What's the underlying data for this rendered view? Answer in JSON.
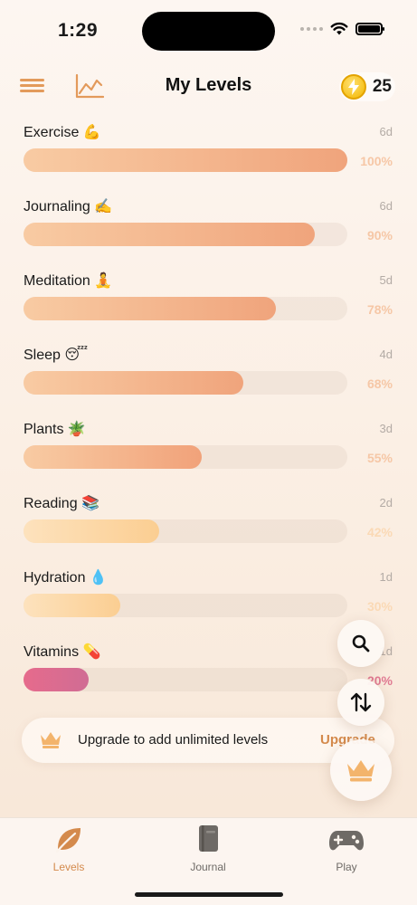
{
  "status_bar": {
    "time": "1:29"
  },
  "header": {
    "title": "My Levels",
    "coin_count": "25"
  },
  "levels": [
    {
      "name": "Exercise 💪",
      "days": "6d",
      "percent_label": "100%",
      "progress": 1.0,
      "fill_start": "#f8cba3",
      "fill_end": "#f0a47c",
      "pct_color": "#f6c7a6"
    },
    {
      "name": "Journaling ✍️",
      "days": "6d",
      "percent_label": "90%",
      "progress": 0.9,
      "fill_start": "#f8cba3",
      "fill_end": "#f0a47c",
      "pct_color": "#f6c7a6"
    },
    {
      "name": "Meditation 🧘",
      "days": "5d",
      "percent_label": "78%",
      "progress": 0.78,
      "fill_start": "#f8cba3",
      "fill_end": "#f0a47c",
      "pct_color": "#f6c7a6"
    },
    {
      "name": "Sleep 😴",
      "days": "4d",
      "percent_label": "68%",
      "progress": 0.68,
      "fill_start": "#f8cba3",
      "fill_end": "#f0a47c",
      "pct_color": "#f6c7a6"
    },
    {
      "name": "Plants 🪴",
      "days": "3d",
      "percent_label": "55%",
      "progress": 0.55,
      "fill_start": "#f8cba3",
      "fill_end": "#f1a27a",
      "pct_color": "#f6c7a6"
    },
    {
      "name": "Reading 📚",
      "days": "2d",
      "percent_label": "42%",
      "progress": 0.42,
      "fill_start": "#fde2bd",
      "fill_end": "#fbce92",
      "pct_color": "#fad9b5"
    },
    {
      "name": "Hydration 💧",
      "days": "1d",
      "percent_label": "30%",
      "progress": 0.3,
      "fill_start": "#fde2bd",
      "fill_end": "#fbce92",
      "pct_color": "#fad9b5"
    },
    {
      "name": "Vitamins 💊",
      "days": "1d",
      "percent_label": "20%",
      "progress": 0.2,
      "fill_start": "#e66b8c",
      "fill_end": "#d06c94",
      "pct_color": "#e07a92"
    }
  ],
  "upgrade": {
    "text": "Upgrade to add unlimited levels",
    "action": "Upgrade"
  },
  "tabs": [
    {
      "label": "Levels",
      "active": true
    },
    {
      "label": "Journal",
      "active": false
    },
    {
      "label": "Play",
      "active": false
    }
  ],
  "colors": {
    "accent": "#d48a4c",
    "inactive": "#6e6a66"
  }
}
